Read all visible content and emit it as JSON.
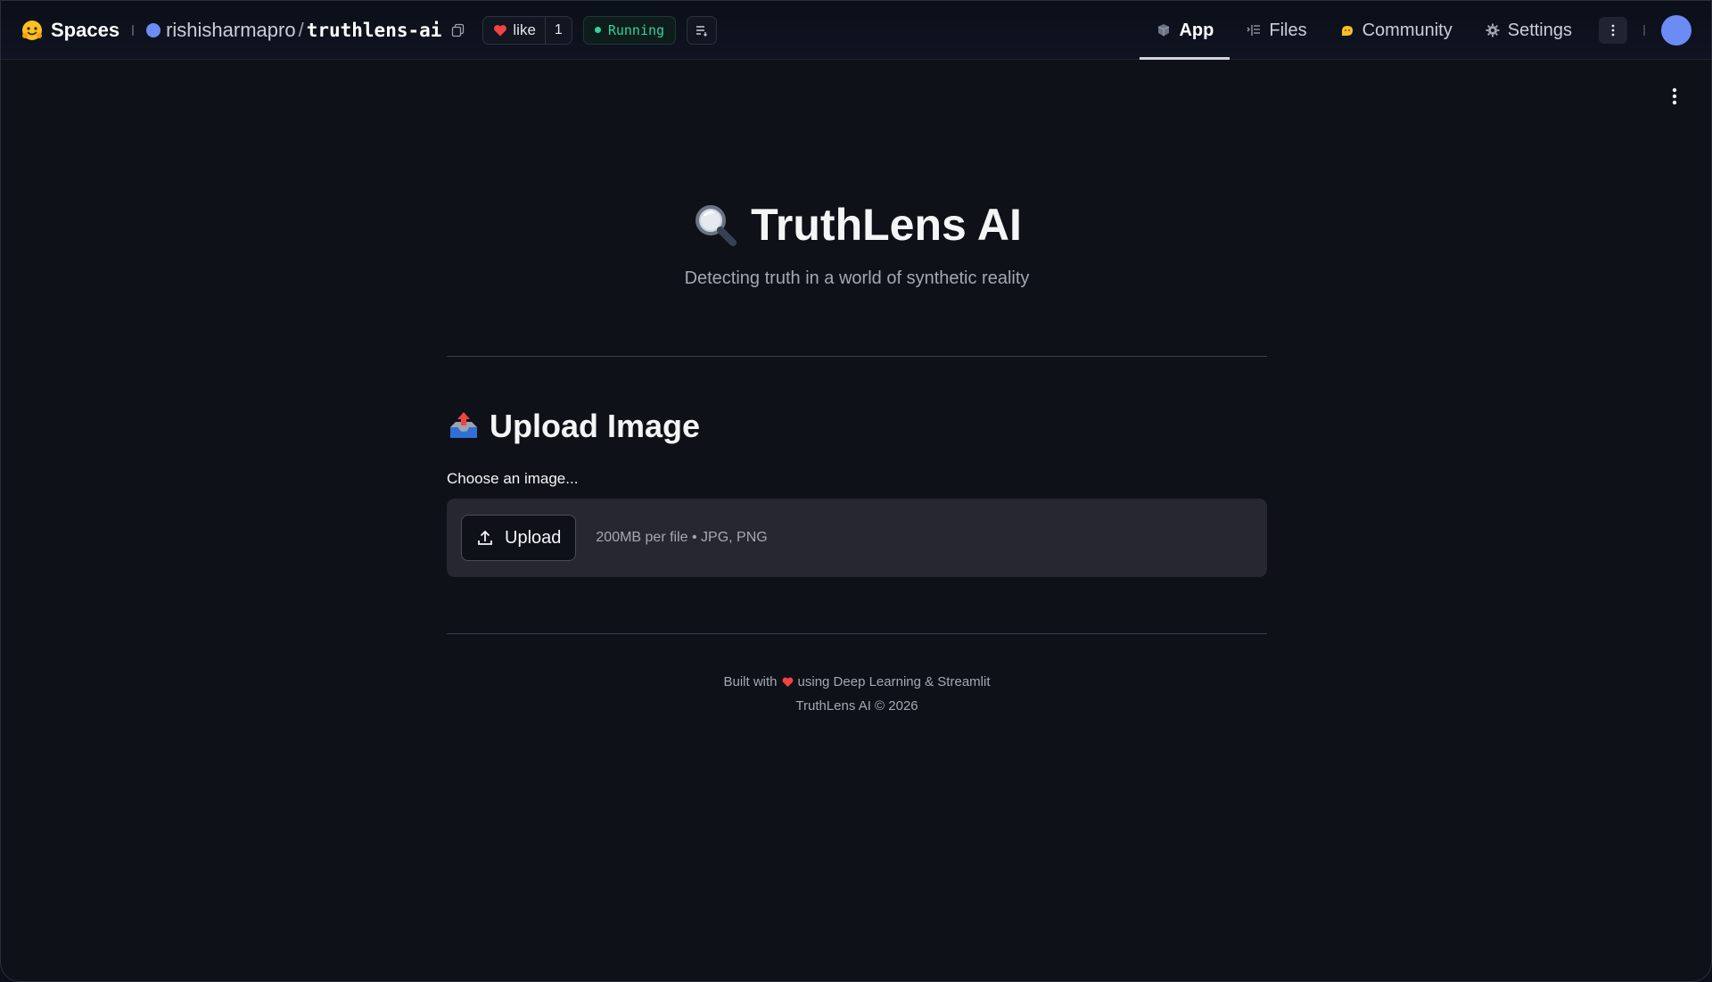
{
  "header": {
    "brand": "Spaces",
    "owner": "rishisharmapro",
    "slash": "/",
    "repo": "truthlens-ai",
    "like_label": "like",
    "like_count": "1",
    "status": "Running"
  },
  "nav": {
    "items": [
      {
        "label": "App",
        "icon": "cube-icon"
      },
      {
        "label": "Files",
        "icon": "files-icon"
      },
      {
        "label": "Community",
        "icon": "community-icon"
      },
      {
        "label": "Settings",
        "icon": "gear-icon"
      }
    ],
    "active": "App"
  },
  "main": {
    "title": "TruthLens AI",
    "subtitle": "Detecting truth in a world of synthetic reality",
    "section_title": "Upload Image",
    "uploader_label": "Choose an image...",
    "upload_button": "Upload",
    "upload_hint": "200MB per file • JPG, PNG"
  },
  "footer": {
    "built_prefix": "Built with",
    "built_suffix": "using Deep Learning & Streamlit",
    "copyright": "TruthLens AI © 2026"
  },
  "colors": {
    "background": "#0e1117",
    "dropzone": "#262730",
    "status_green": "#34d399",
    "avatar": "#6b8cf5",
    "heart": "#ef4444"
  }
}
